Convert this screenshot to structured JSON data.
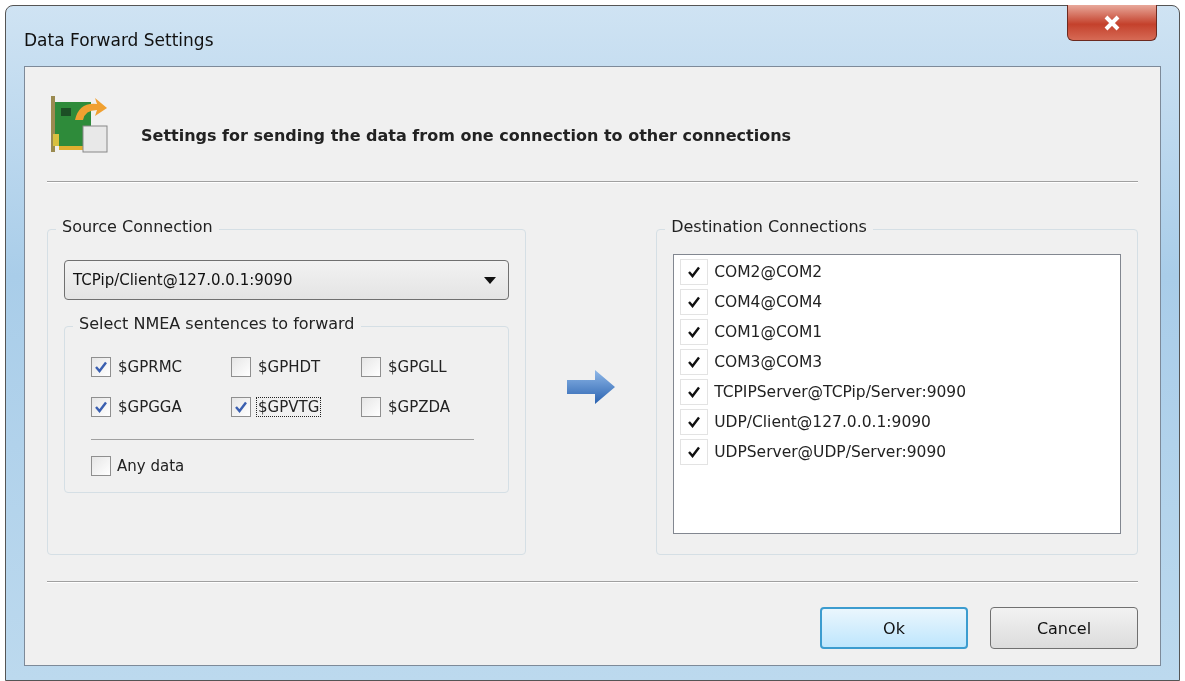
{
  "window": {
    "title": "Data Forward Settings"
  },
  "header": {
    "text": "Settings for sending the data from one connection to other connections"
  },
  "source": {
    "title": "Source Connection",
    "connection": "TCPip/Client@127.0.0.1:9090",
    "sentences_title": "Select NMEA sentences to forward",
    "sentences": [
      {
        "label": "$GPRMC",
        "checked": true,
        "focused": false
      },
      {
        "label": "$GPHDT",
        "checked": false,
        "focused": false
      },
      {
        "label": "$GPGLL",
        "checked": false,
        "focused": false
      },
      {
        "label": "$GPGGA",
        "checked": true,
        "focused": false
      },
      {
        "label": "$GPVTG",
        "checked": true,
        "focused": true
      },
      {
        "label": "$GPZDA",
        "checked": false,
        "focused": false
      }
    ],
    "any_data": {
      "label": "Any data",
      "checked": false
    }
  },
  "destination": {
    "title": "Destination Connections",
    "items": [
      {
        "label": "COM2@COM2",
        "checked": true
      },
      {
        "label": "COM4@COM4",
        "checked": true
      },
      {
        "label": "COM1@COM1",
        "checked": true
      },
      {
        "label": "COM3@COM3",
        "checked": true
      },
      {
        "label": "TCPIPServer@TCPip/Server:9090",
        "checked": true
      },
      {
        "label": "UDP/Client@127.0.0.1:9090",
        "checked": true
      },
      {
        "label": "UDPServer@UDP/Server:9090",
        "checked": true
      }
    ]
  },
  "buttons": [
    {
      "label": "Ok",
      "default": true
    },
    {
      "label": "Cancel",
      "default": false
    }
  ]
}
